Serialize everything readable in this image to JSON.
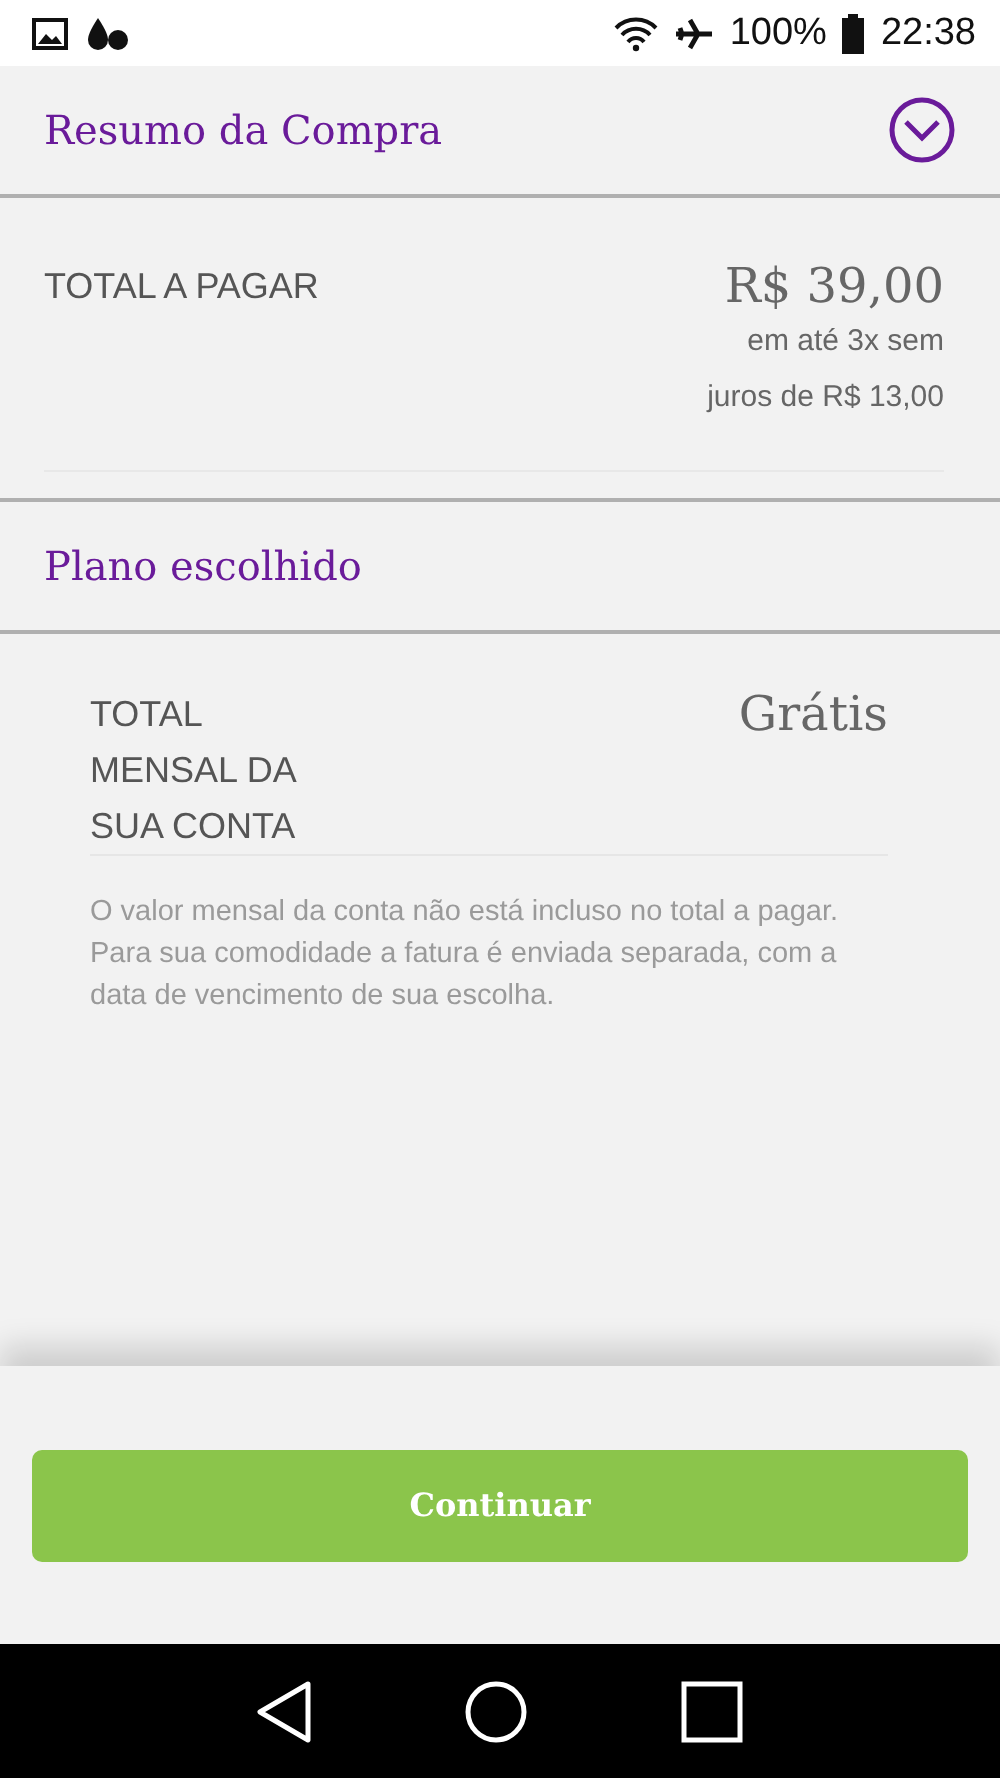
{
  "status_bar": {
    "battery": "100%",
    "time": "22:38"
  },
  "summary_header": {
    "title": "Resumo da Compra"
  },
  "total": {
    "label": "TOTAL A PAGAR",
    "amount": "R$ 39,00",
    "installments": [
      "em até 3x sem",
      "juros de R$ 13,00"
    ]
  },
  "plan_header": {
    "title": "Plano escolhido"
  },
  "monthly": {
    "label": [
      "TOTAL",
      "MENSAL DA",
      "SUA CONTA"
    ],
    "value": "Grátis",
    "note": "O valor mensal da conta não está incluso no total a pagar. Para sua comodidade a fatura é enviada separada, com a data de vencimento de sua escolha."
  },
  "continue_button": {
    "label": "Continuar"
  }
}
